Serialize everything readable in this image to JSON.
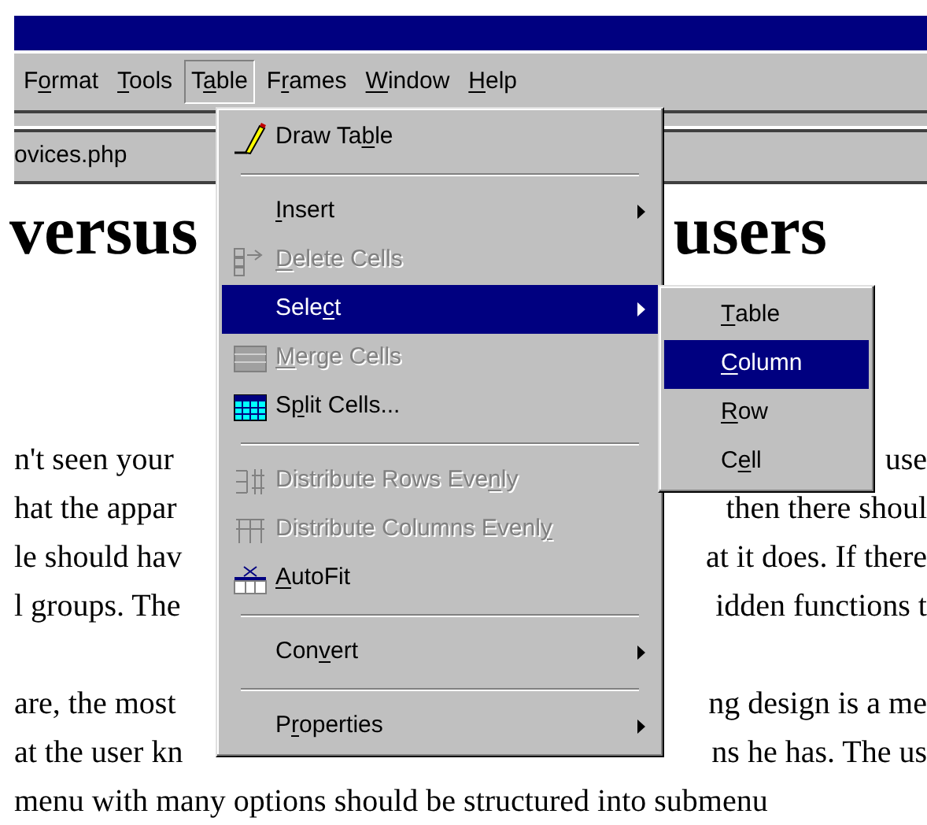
{
  "menu_bar": [
    {
      "label": {
        "before": "F",
        "key": "o",
        "after": "rmat"
      },
      "selected": false
    },
    {
      "label": {
        "key": "T",
        "after": "ools"
      },
      "selected": false
    },
    {
      "label": {
        "before": "T",
        "key": "a",
        "after": "ble"
      },
      "selected": true
    },
    {
      "label": {
        "before": "F",
        "key": "r",
        "after": "ames"
      },
      "selected": false
    },
    {
      "label": {
        "key": "W",
        "after": "indow"
      },
      "selected": false
    },
    {
      "label": {
        "key": "H",
        "after": "elp"
      },
      "selected": false
    }
  ],
  "document_tab": {
    "label": "ovices.php"
  },
  "heading": {
    "left": "versus",
    "right": "users"
  },
  "body_lines": [
    {
      "left": "n't seen your",
      "right": "use"
    },
    {
      "left": "hat the appar",
      "right": "then there shoul"
    },
    {
      "left": "le should hav",
      "right": "at it does. If there"
    },
    {
      "left": "l groups. The",
      "right": "idden functions t"
    },
    {
      "left": "are, the most",
      "right": "ng design is a me"
    },
    {
      "left": "at the user kn",
      "right": "ns he has. The us"
    },
    {
      "left": "menu with many options should be structured into submenu"
    }
  ],
  "table_menu": [
    {
      "kind": "item",
      "label": {
        "before": "Draw Ta",
        "key": "b",
        "after": "le"
      },
      "disabled": false,
      "selected": false,
      "submenu": false
    },
    {
      "kind": "separator"
    },
    {
      "kind": "item",
      "label": {
        "key": "I",
        "after": "nsert"
      },
      "disabled": false,
      "selected": false,
      "submenu": true
    },
    {
      "kind": "item",
      "label": {
        "key": "D",
        "after": "elete Cells"
      },
      "disabled": true,
      "selected": false,
      "submenu": false
    },
    {
      "kind": "item",
      "label": {
        "before": "Sele",
        "key": "c",
        "after": "t"
      },
      "disabled": false,
      "selected": true,
      "submenu": true
    },
    {
      "kind": "item",
      "label": {
        "key": "M",
        "after": "erge Cells"
      },
      "disabled": true,
      "selected": false,
      "submenu": false
    },
    {
      "kind": "item",
      "label": {
        "before": "S",
        "key": "p",
        "after": "lit Cells..."
      },
      "disabled": false,
      "selected": false,
      "submenu": false
    },
    {
      "kind": "separator"
    },
    {
      "kind": "item",
      "label": {
        "before": "Distribute Rows Eve",
        "key": "n",
        "after": "ly"
      },
      "disabled": true,
      "selected": false,
      "submenu": false
    },
    {
      "kind": "item",
      "label": {
        "before": "Distribute Columns Evenl",
        "key": "y"
      },
      "disabled": true,
      "selected": false,
      "submenu": false
    },
    {
      "kind": "item",
      "label": {
        "key": "A",
        "after": "utoFit"
      },
      "disabled": false,
      "selected": false,
      "submenu": false
    },
    {
      "kind": "separator"
    },
    {
      "kind": "item",
      "label": {
        "before": "Con",
        "key": "v",
        "after": "ert"
      },
      "disabled": false,
      "selected": false,
      "submenu": true
    },
    {
      "kind": "separator"
    },
    {
      "kind": "item",
      "label": {
        "before": "P",
        "key": "r",
        "after": "operties"
      },
      "disabled": false,
      "selected": false,
      "submenu": true
    }
  ],
  "select_submenu": [
    {
      "label": {
        "key": "T",
        "after": "able"
      },
      "selected": false
    },
    {
      "label": {
        "key": "C",
        "after": "olumn"
      },
      "selected": true
    },
    {
      "label": {
        "key": "R",
        "after": "ow"
      },
      "selected": false
    },
    {
      "label": {
        "before": "C",
        "key": "e",
        "after": "ll"
      },
      "selected": false
    }
  ]
}
